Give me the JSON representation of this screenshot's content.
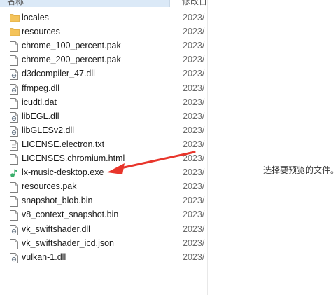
{
  "header": {
    "name_label": "名称",
    "date_label": "修改日期"
  },
  "files": [
    {
      "name": "locales",
      "date": "2023/",
      "type": "folder"
    },
    {
      "name": "resources",
      "date": "2023/",
      "type": "folder"
    },
    {
      "name": "chrome_100_percent.pak",
      "date": "2023/",
      "type": "file"
    },
    {
      "name": "chrome_200_percent.pak",
      "date": "2023/",
      "type": "file"
    },
    {
      "name": "d3dcompiler_47.dll",
      "date": "2023/",
      "type": "dll"
    },
    {
      "name": "ffmpeg.dll",
      "date": "2023/",
      "type": "dll"
    },
    {
      "name": "icudtl.dat",
      "date": "2023/",
      "type": "file"
    },
    {
      "name": "libEGL.dll",
      "date": "2023/",
      "type": "dll"
    },
    {
      "name": "libGLESv2.dll",
      "date": "2023/",
      "type": "dll"
    },
    {
      "name": "LICENSE.electron.txt",
      "date": "2023/",
      "type": "text"
    },
    {
      "name": "LICENSES.chromium.html",
      "date": "2023/",
      "type": "file"
    },
    {
      "name": "lx-music-desktop.exe",
      "date": "2023/",
      "type": "exe"
    },
    {
      "name": "resources.pak",
      "date": "2023/",
      "type": "file"
    },
    {
      "name": "snapshot_blob.bin",
      "date": "2023/",
      "type": "file"
    },
    {
      "name": "v8_context_snapshot.bin",
      "date": "2023/",
      "type": "file"
    },
    {
      "name": "vk_swiftshader.dll",
      "date": "2023/",
      "type": "dll"
    },
    {
      "name": "vk_swiftshader_icd.json",
      "date": "2023/",
      "type": "file"
    },
    {
      "name": "vulkan-1.dll",
      "date": "2023/",
      "type": "dll"
    }
  ],
  "preview": {
    "message": "选择要预览的文件。"
  },
  "icons": {
    "folder": "folder-icon",
    "file": "file-icon",
    "dll": "dll-file-icon",
    "text": "text-file-icon",
    "exe": "music-app-icon"
  },
  "colors": {
    "folder": "#f4c35a",
    "header_selected": "#dbe9f7",
    "arrow": "#e8352b",
    "exe_icon": "#3aae6a"
  }
}
